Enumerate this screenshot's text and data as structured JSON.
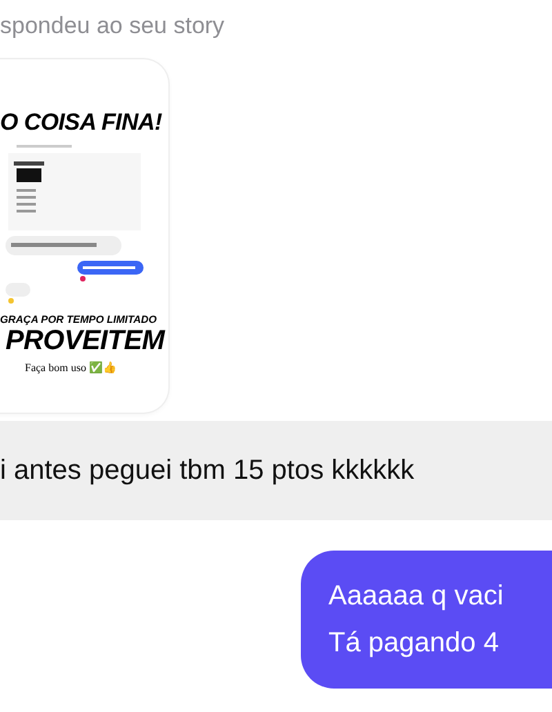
{
  "reply_notice": "spondeu ao seu story",
  "story": {
    "headline": "O COISA FINA!",
    "subline": "GRAÇA POR TEMPO LIMITADO",
    "big_word": "PROVEITEM",
    "caption": "Faça bom uso ✅👍"
  },
  "messages": [
    {
      "kind": "received",
      "lines": [
        "i antes peguei tbm 15 ptos kkkkkk"
      ]
    },
    {
      "kind": "sent",
      "lines": [
        "Aaaaaa q vaci",
        "Tá pagando 4"
      ]
    }
  ]
}
